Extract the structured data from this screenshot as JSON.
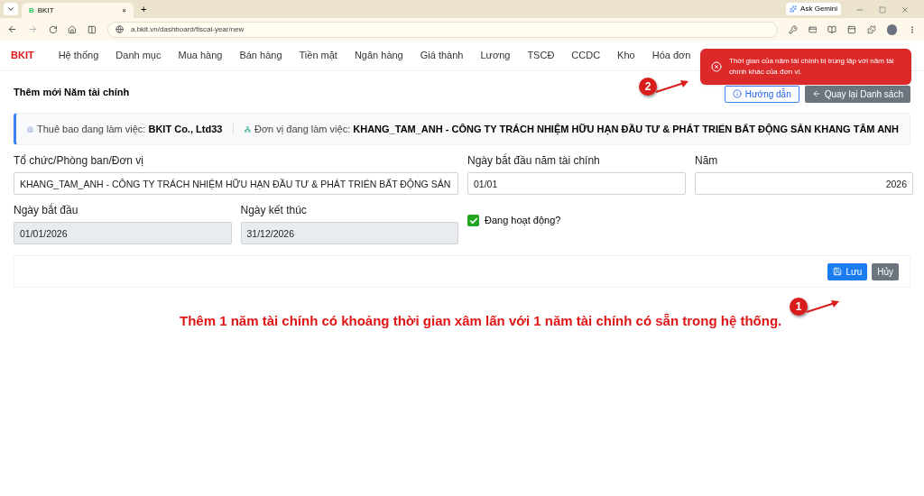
{
  "browser": {
    "favicon": "B",
    "tab_title": "BKIT",
    "tab_close": "×",
    "new_tab": "+",
    "url": "a.bkit.vn/dashboard/fiscal-year/new",
    "ask_gemini": "Ask Gemini"
  },
  "app": {
    "logo": "BKIT",
    "menu": [
      "Hệ thống",
      "Danh mục",
      "Mua hàng",
      "Bán hàng",
      "Tiền mặt",
      "Ngân hàng",
      "Giá thành",
      "Lương",
      "TSCĐ",
      "CCDC",
      "Kho",
      "Hóa đơn"
    ]
  },
  "page": {
    "title": "Thêm mới Năm tài chính",
    "buttons": [
      {
        "kind": "guide",
        "label": "Hướng dẫn"
      },
      {
        "kind": "back",
        "label": "Quay lại Danh sách"
      }
    ]
  },
  "context": {
    "subscription_label": "Thuê bao đang làm việc:",
    "subscription": "BKIT Co., Ltd33",
    "unit_label": "Đơn vị đang làm việc:",
    "unit": "KHANG_TAM_ANH - CÔNG TY TRÁCH NHIỆM HỮU HẠN ĐẦU TƯ & PHÁT TRIỂN BẤT ĐỘNG SẢN KHANG TÂM ANH"
  },
  "form": {
    "fields": [
      {
        "label": "Tổ chức/Phòng ban/Đơn vị",
        "value": "KHANG_TAM_ANH - CÔNG TY TRÁCH NHIỆM HỮU HẠN ĐẦU TƯ & PHÁT TRIỂN BẤT ĐỘNG SẢN",
        "disabled": false,
        "kind": "text"
      },
      {
        "label": "Ngày bắt đầu năm tài chính",
        "value": "01/01",
        "disabled": false,
        "kind": "text"
      },
      {
        "label": "Năm",
        "value": "2026",
        "disabled": false,
        "kind": "number"
      },
      {
        "label": "Ngày bắt đầu",
        "value": "01/01/2026",
        "disabled": true,
        "kind": "text"
      },
      {
        "label": "Ngày kết thúc",
        "value": "31/12/2026",
        "disabled": true,
        "kind": "text"
      }
    ],
    "active": {
      "label": "Đang hoạt động?",
      "checked": true
    },
    "actions": [
      {
        "kind": "save",
        "label": "Lưu"
      },
      {
        "kind": "cancel",
        "label": "Hủy"
      }
    ]
  },
  "toast": {
    "message": "Thời gian của năm tài chính bị trùng lặp với năm tài chính khác của đơn vị."
  },
  "annotations": {
    "markers": [
      "1",
      "2"
    ],
    "caption": "Thêm 1 năm tài chính có khoảng thời gian xâm lấn với 1 năm tài chính có sẵn trong hệ thống."
  }
}
